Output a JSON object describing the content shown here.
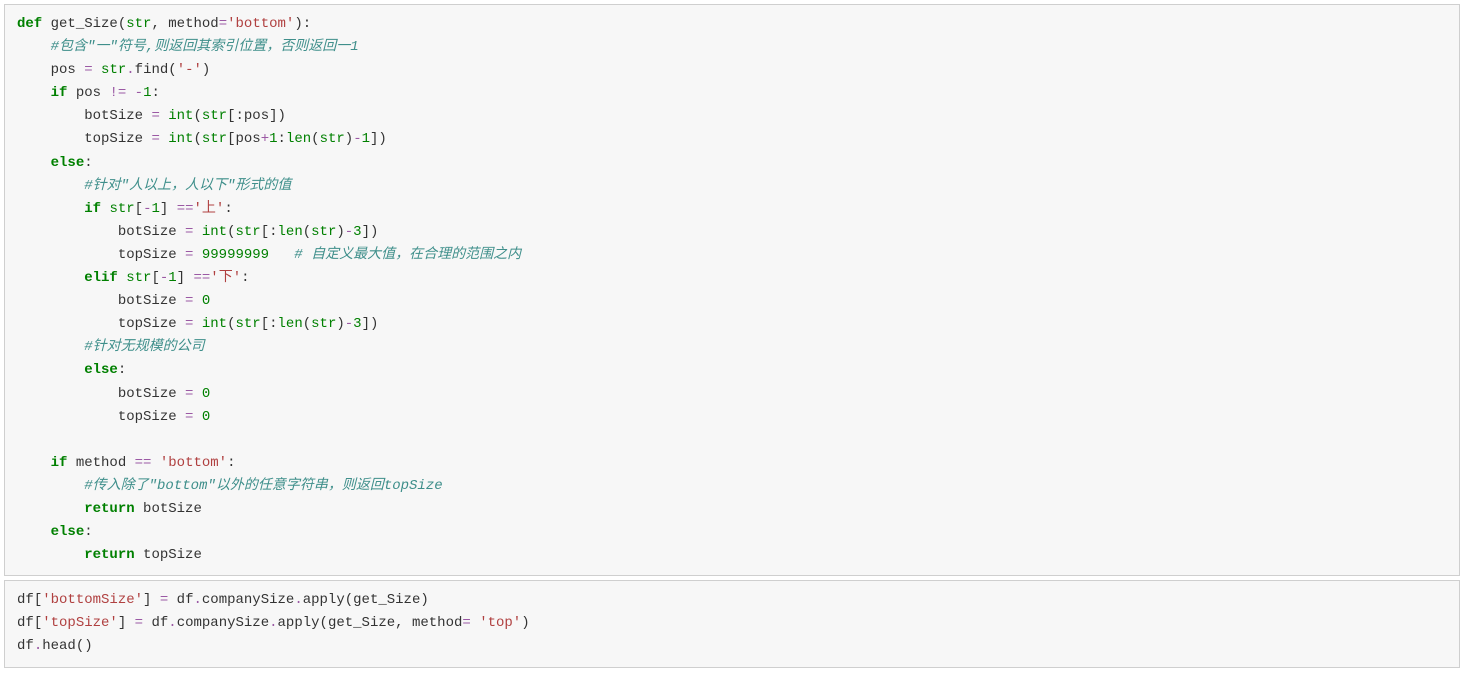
{
  "block1": {
    "line1": {
      "def": "def",
      "fname": "get_Size",
      "p1": "str",
      "p2": "method",
      "eq": "=",
      "defv": "'bottom'",
      "colon": ":"
    },
    "line2": {
      "comment": "#包含\"一\"符号,则返回其索引位置，否则返回一1"
    },
    "line3": {
      "pos": "pos",
      "eq": "=",
      "strv": "str",
      "dot": ".",
      "find": "find",
      "arg": "'-'"
    },
    "line4": {
      "ifk": "if",
      "pos": "pos",
      "ne": "!=",
      "neg": "-",
      "one": "1",
      "colon": ":"
    },
    "line5": {
      "bot": "botSize",
      "eq": "=",
      "intf": "int",
      "strv": "str",
      "colon": ":",
      "pos": "pos"
    },
    "line6": {
      "top": "topSize",
      "eq": "=",
      "intf": "int",
      "strv": "str",
      "pos": "pos",
      "plus": "+",
      "one": "1",
      "colon": ":",
      "lenf": "len",
      "str2": "str",
      "minus": "-",
      "one2": "1"
    },
    "line7": {
      "elsek": "else",
      "colon": ":"
    },
    "line8": {
      "comment": "#针对\"人以上，人以下\"形式的值"
    },
    "line9": {
      "ifk": "if",
      "strv": "str",
      "neg": "-",
      "one": "1",
      "eq": "==",
      "up": "'上'",
      "colon": ":"
    },
    "line10": {
      "bot": "botSize",
      "eq": "=",
      "intf": "int",
      "strv": "str",
      "colon": ":",
      "lenf": "len",
      "str2": "str",
      "minus": "-",
      "three": "3"
    },
    "line11": {
      "top": "topSize",
      "eq": "=",
      "big": "99999999",
      "comment": "# 自定义最大值，在合理的范围之内"
    },
    "line12": {
      "elifk": "elif",
      "strv": "str",
      "neg": "-",
      "one": "1",
      "eq": "==",
      "down": "'下'",
      "colon": ":"
    },
    "line13": {
      "bot": "botSize",
      "eq": "=",
      "zero": "0"
    },
    "line14": {
      "top": "topSize",
      "eq": "=",
      "intf": "int",
      "strv": "str",
      "colon": ":",
      "lenf": "len",
      "str2": "str",
      "minus": "-",
      "three": "3"
    },
    "line15": {
      "comment": "#针对无规模的公司"
    },
    "line16": {
      "elsek": "else",
      "colon": ":"
    },
    "line17": {
      "bot": "botSize",
      "eq": "=",
      "zero": "0"
    },
    "line18": {
      "top": "topSize",
      "eq": "=",
      "zero": "0"
    },
    "line19": {
      "ifk": "if",
      "method": "method",
      "eq": "==",
      "bottom": "'bottom'",
      "colon": ":"
    },
    "line20": {
      "comment": "#传入除了\"bottom\"以外的任意字符串，则返回topSize"
    },
    "line21": {
      "ret": "return",
      "bot": "botSize"
    },
    "line22": {
      "elsek": "else",
      "colon": ":"
    },
    "line23": {
      "ret": "return",
      "top": "topSize"
    }
  },
  "block2": {
    "l1": {
      "df": "df",
      "key": "'bottomSize'",
      "eq": "=",
      "df2": "df",
      "dot": ".",
      "cs": "companySize",
      "dot2": ".",
      "apply": "apply",
      "fn": "get_Size"
    },
    "l2": {
      "df": "df",
      "key": "'topSize'",
      "eq": "=",
      "df2": "df",
      "dot": ".",
      "cs": "companySize",
      "dot2": ".",
      "apply": "apply",
      "fn": "get_Size",
      "comma": ",",
      "method": "method",
      "eq2": "=",
      "top": "'top'"
    },
    "l3": {
      "df": "df",
      "dot": ".",
      "head": "head"
    }
  }
}
